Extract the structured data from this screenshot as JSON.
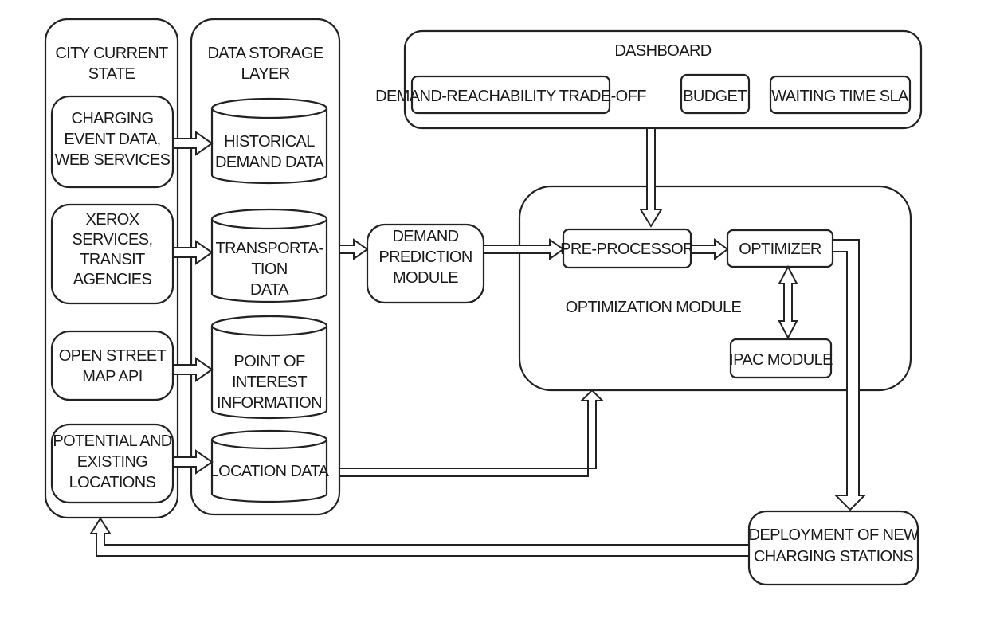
{
  "diagram": {
    "city_current_state": {
      "title": [
        "CITY CURRENT",
        "STATE"
      ],
      "sources": [
        {
          "lines": [
            "CHARGING",
            "EVENT DATA,",
            "WEB SERVICES"
          ]
        },
        {
          "lines": [
            "XEROX",
            "SERVICES,",
            "TRANSIT",
            "AGENCIES"
          ]
        },
        {
          "lines": [
            "OPEN STREET",
            "MAP API"
          ]
        },
        {
          "lines": [
            "POTENTIAL AND",
            "EXISTING",
            "LOCATIONS"
          ]
        }
      ]
    },
    "data_storage_layer": {
      "title": [
        "DATA STORAGE",
        "LAYER"
      ],
      "stores": [
        {
          "lines": [
            "HISTORICAL",
            "DEMAND DATA"
          ]
        },
        {
          "lines": [
            "TRANSPORTA-",
            "TION",
            "DATA"
          ]
        },
        {
          "lines": [
            "POINT OF",
            "INTEREST",
            "INFORMATION"
          ]
        },
        {
          "lines": [
            "LOCATION DATA"
          ]
        }
      ]
    },
    "demand_prediction": {
      "lines": [
        "DEMAND",
        "PREDICTION",
        "MODULE"
      ]
    },
    "dashboard": {
      "title": "DASHBOARD",
      "items": [
        "DEMAND-REACHABILITY TRADE-OFF",
        "BUDGET",
        "WAITING TIME SLA"
      ]
    },
    "optimization_module": {
      "title": "OPTIMIZATION MODULE",
      "pre_processor": "PRE-PROCESSOR",
      "optimizer": "OPTIMIZER",
      "ipac": "IPAC MODULE"
    },
    "deployment": {
      "lines": [
        "DEPLOYMENT OF NEW",
        "CHARGING STATIONS"
      ]
    }
  }
}
